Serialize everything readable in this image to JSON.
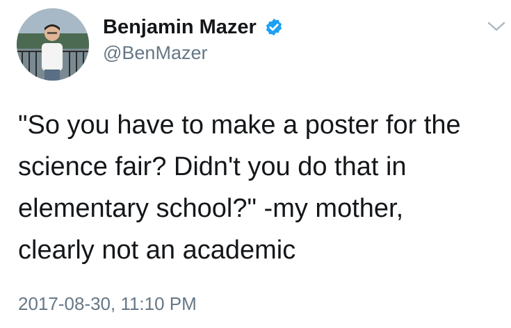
{
  "author": {
    "display_name": "Benjamin Mazer",
    "handle": "@BenMazer",
    "verified": true
  },
  "tweet": {
    "text": "\"So you have to make a poster for the\nscience fair? Didn't you do that in\nelementary school?\" -my mother,\nclearly not an academic",
    "timestamp": "2017-08-30, 11:10 PM"
  },
  "icons": {
    "verified": "verified-badge-icon",
    "menu": "chevron-down-icon"
  },
  "colors": {
    "text": "#14171a",
    "secondary": "#657786",
    "verified": "#1da1f2"
  }
}
